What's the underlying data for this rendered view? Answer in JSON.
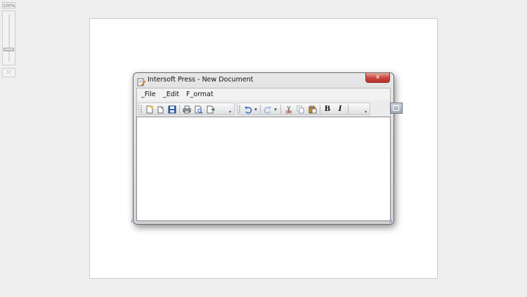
{
  "zoom": {
    "level_label": "100%",
    "slider_value_percent": 100,
    "fit_icon": "fit-to-window-icon"
  },
  "window": {
    "title": "Intersoft Press - New Document",
    "app_icon": "document-edit-icon",
    "close_glyph": "x"
  },
  "menu": {
    "items": [
      {
        "label": "_File"
      },
      {
        "label": "_Edit"
      },
      {
        "label": "F_ormat"
      }
    ]
  },
  "toolbar": {
    "file_group": [
      "new-document-icon",
      "open-file-icon",
      "save-icon",
      "print-icon",
      "print-preview-icon",
      "export-icon"
    ],
    "edit_group": [
      "undo-icon",
      "redo-icon",
      "cut-icon",
      "copy-icon",
      "paste-icon"
    ],
    "bold_label": "B",
    "italic_label": "I"
  },
  "editor": {
    "content": ""
  },
  "colors": {
    "canvas_bg": "#ffffff",
    "page_bg": "#eeeeee",
    "close_red": "#c8443a",
    "accent_blue": "#2f6fc2"
  }
}
